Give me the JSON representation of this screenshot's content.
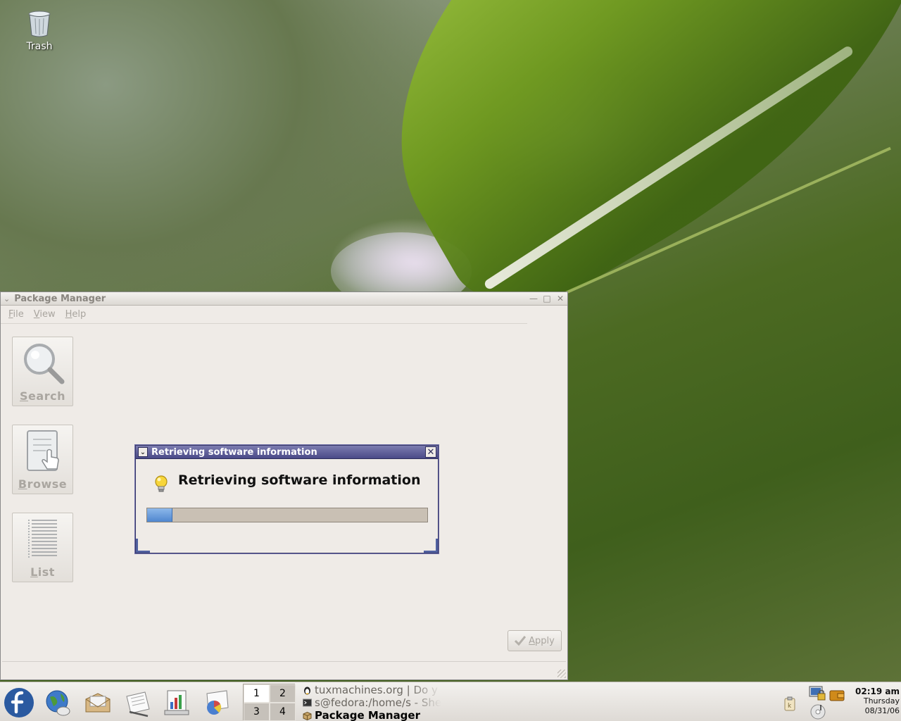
{
  "desktop": {
    "icons": [
      {
        "label": "Trash",
        "icon": "trash-icon"
      }
    ]
  },
  "window": {
    "title": "Package Manager",
    "menu": [
      {
        "label": "File",
        "mnemonic": "F",
        "rest": "ile"
      },
      {
        "label": "View",
        "mnemonic": "V",
        "rest": "iew"
      },
      {
        "label": "Help",
        "mnemonic": "H",
        "rest": "elp"
      }
    ],
    "sidebar": [
      {
        "label": "Search",
        "mnemonic": "S",
        "rest": "earch",
        "icon": "magnifier-icon"
      },
      {
        "label": "Browse",
        "mnemonic": "B",
        "rest": "rowse",
        "icon": "browse-hand-icon"
      },
      {
        "label": "List",
        "mnemonic": "L",
        "rest": "ist",
        "icon": "list-icon"
      }
    ],
    "apply": {
      "label": "Apply",
      "mnemonic": "A",
      "rest": "pply",
      "icon": "check-icon"
    }
  },
  "dialog": {
    "title": "Retrieving software information",
    "heading": "Retrieving software information",
    "icon": "lightbulb-icon",
    "progress_percent": 9
  },
  "panel": {
    "launchers": [
      "fedora-logo-icon",
      "web-browser-icon",
      "email-icon",
      "text-editor-icon",
      "presentation-icon",
      "spreadsheet-icon"
    ],
    "workspaces": [
      "1",
      "2",
      "3",
      "4"
    ],
    "active_workspace": "1",
    "tasks": [
      {
        "label": "tuxmachines.org | Do y",
        "icon": "tux-icon",
        "active": false
      },
      {
        "label": "s@fedora:/home/s - She",
        "icon": "terminal-icon",
        "active": false
      },
      {
        "label": "Package Manager",
        "icon": "package-icon",
        "active": true
      }
    ],
    "clock": {
      "time": "02:19 am",
      "day": "Thursday",
      "date": "08/31/06"
    }
  },
  "colors": {
    "dialog_title": "#4a4a88",
    "progress_fill": "#4f86cf",
    "window_bg": "#efebe7"
  }
}
